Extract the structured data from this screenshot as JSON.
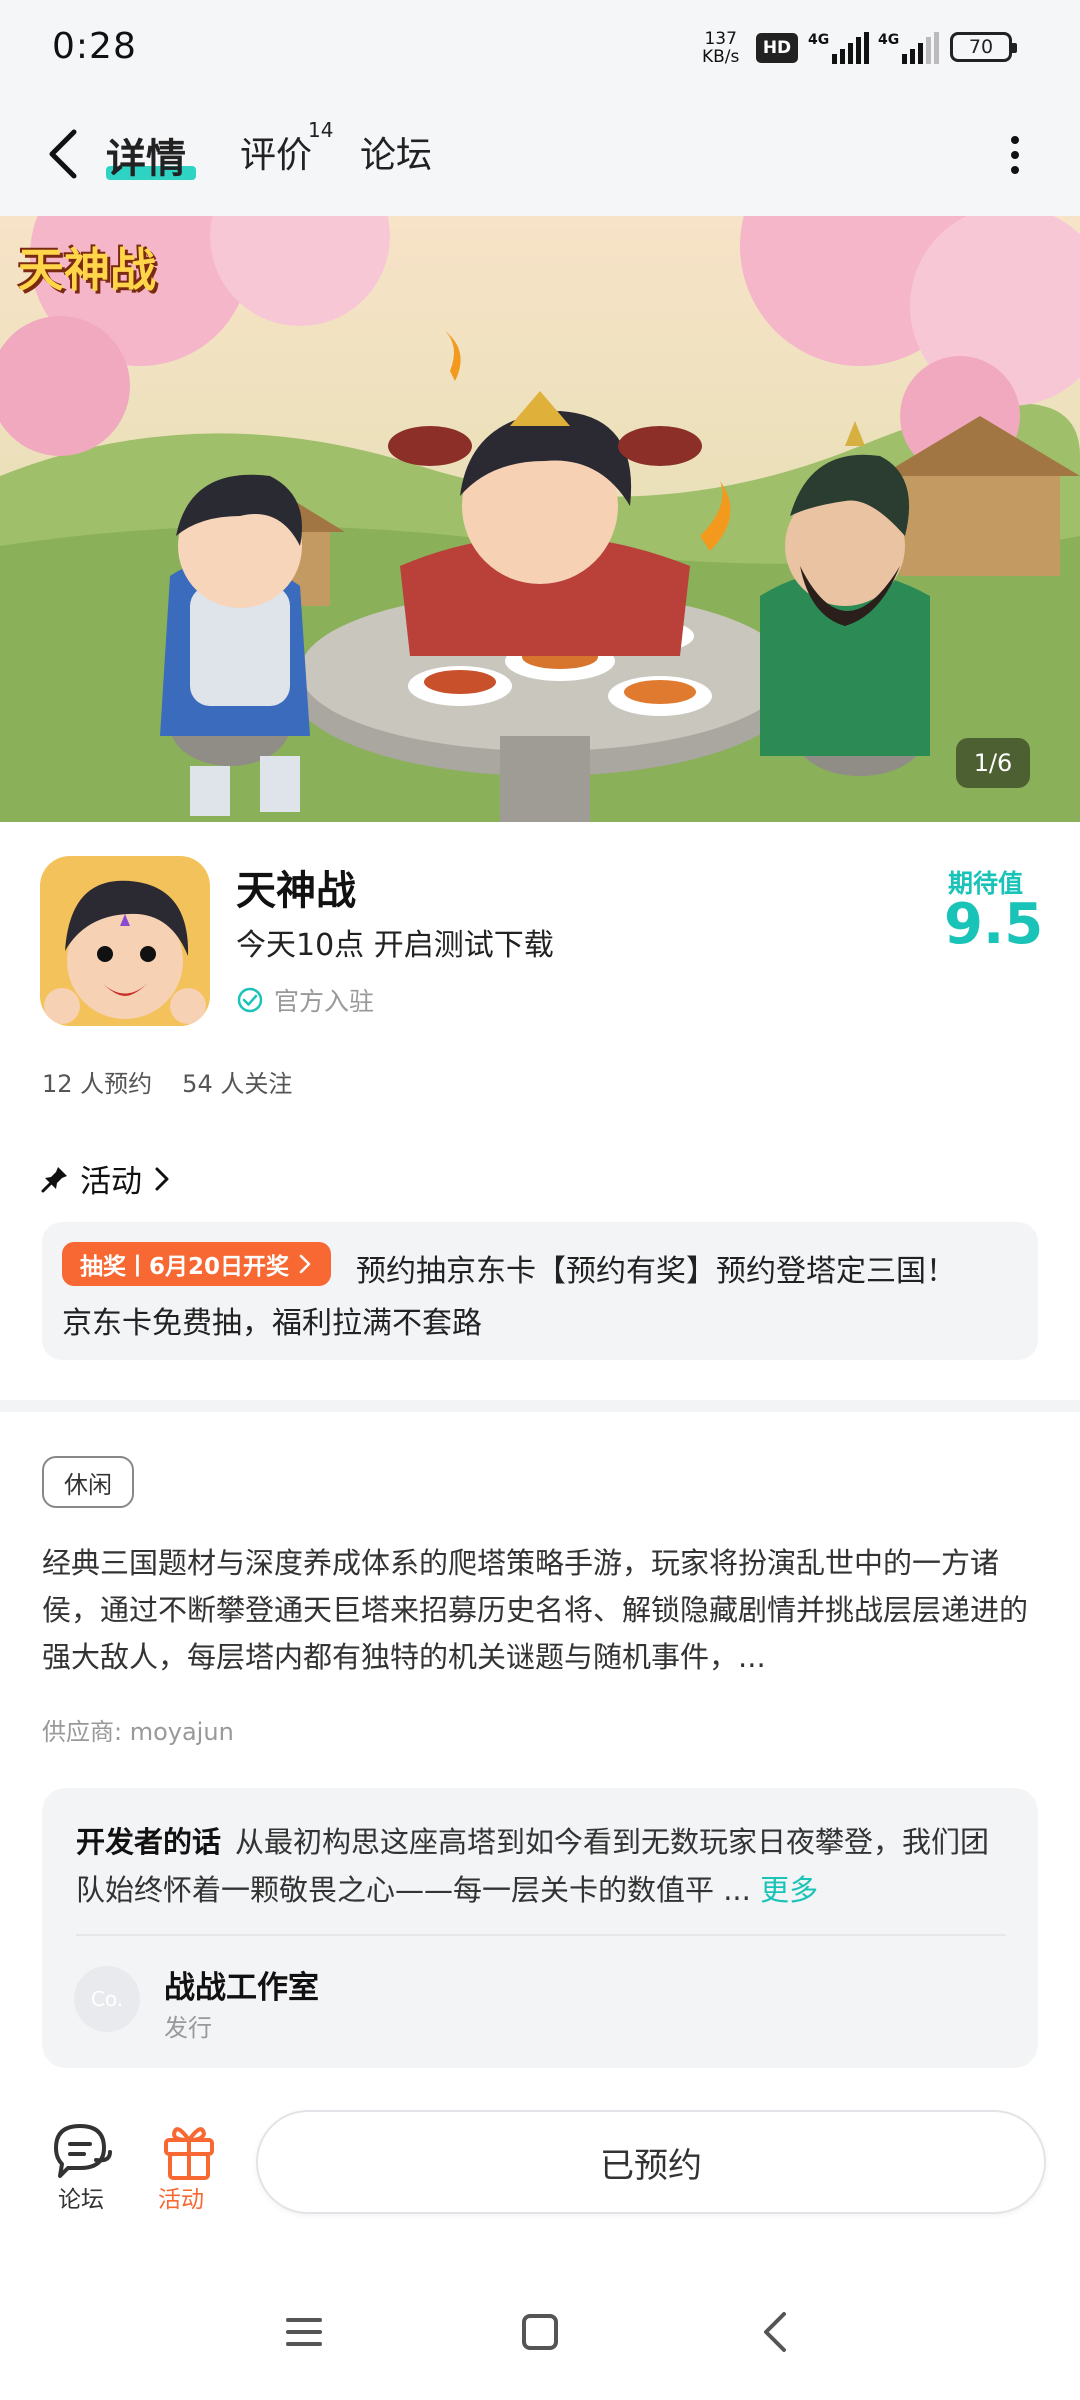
{
  "status_bar": {
    "time": "0:28",
    "net_speed_value": "137",
    "net_speed_unit": "KB/s",
    "hd_label": "HD",
    "signal1_label": "4G",
    "signal2_label": "4G",
    "battery": "70"
  },
  "nav": {
    "tabs": [
      {
        "label": "详情",
        "active": true
      },
      {
        "label": "评价",
        "badge": "14"
      },
      {
        "label": "论坛"
      }
    ]
  },
  "banner": {
    "title_art": "天神战",
    "page_indicator": "1/6"
  },
  "game": {
    "name": "天神战",
    "test_info": "今天10点 开启测试下载",
    "official": "官方入驻",
    "expect_label": "期待值",
    "expect_value": "9.5",
    "reservations": "12 人预约",
    "followers": "54 人关注"
  },
  "activity": {
    "heading": "活动",
    "badge": "抽奖丨6月20日开奖",
    "line1": "预约抽京东卡【预约有奖】预约登塔定三国！",
    "line2": "京东卡免费抽，福利拉满不套路"
  },
  "description": {
    "tag": "休闲",
    "text": "经典三国题材与深度养成体系的爬塔策略手游，玩家将扮演乱世中的一方诸侯，通过不断攀登通天巨塔来招募历史名将、解锁隐藏剧情并挑战层层递进的强大敌人，每层塔内都有独特的机关谜题与随机事件，...",
    "supplier": "供应商: moyajun"
  },
  "developer": {
    "title": "开发者的话",
    "text": "从最初构思这座高塔到如今看到无数玩家日夜攀登，我们团队始终怀着一颗敬畏之心——每一层关卡的数值平 ...",
    "more": "更多",
    "avatar_text": "Co.",
    "studio": "战战工作室",
    "role": "发行"
  },
  "bottom_bar": {
    "forum_label": "论坛",
    "activity_label": "活动",
    "reserve_label": "已预约"
  },
  "colors": {
    "accent_teal": "#19c3b7",
    "accent_orange": "#f76833"
  }
}
